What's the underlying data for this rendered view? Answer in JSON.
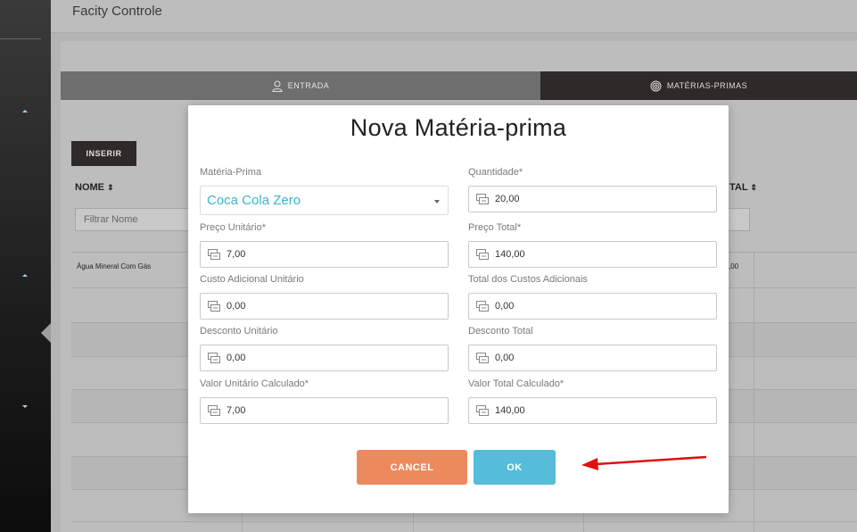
{
  "app": {
    "title": "Facity Controle"
  },
  "tabs": [
    {
      "label": "ENTRADA",
      "icon": "user-icon"
    },
    {
      "label": "MATÉRIAS-PRIMAS",
      "icon": "fingerprint-icon"
    }
  ],
  "toolbar": {
    "insert_label": "INSERIR"
  },
  "table": {
    "columns": [
      "NOME",
      "TAL"
    ],
    "filter_placeholder": "Filtrar Nome",
    "rows": [
      {
        "name": "Água Mineral Com Gás",
        "total": ",00"
      }
    ]
  },
  "modal": {
    "title": "Nova Matéria-prima",
    "fields": {
      "materia_prima": {
        "label": "Matéria-Prima",
        "value": "Coca Cola Zero"
      },
      "quantidade": {
        "label": "Quantidade*",
        "value": "20,00"
      },
      "preco_unitario": {
        "label": "Preço Unitário*",
        "value": "7,00"
      },
      "preco_total": {
        "label": "Preço Total*",
        "value": "140,00"
      },
      "custo_adicional_unitario": {
        "label": "Custo Adicional Unitário",
        "value": "0,00"
      },
      "total_custos_adicionais": {
        "label": "Total dos Custos Adicionais",
        "value": "0,00"
      },
      "desconto_unitario": {
        "label": "Desconto Unitário",
        "value": "0,00"
      },
      "desconto_total": {
        "label": "Desconto Total",
        "value": "0,00"
      },
      "valor_unitario_calculado": {
        "label": "Valor Unitário Calculado*",
        "value": "7,00"
      },
      "valor_total_calculado": {
        "label": "Valor Total Calculado*",
        "value": "140,00"
      }
    },
    "buttons": {
      "cancel": "CANCEL",
      "ok": "OK"
    }
  },
  "colors": {
    "accent_value": "#3ab6cf",
    "cancel_button": "#ec8a5e",
    "ok_button": "#55bcd9",
    "annotation_arrow": "#e01010"
  }
}
